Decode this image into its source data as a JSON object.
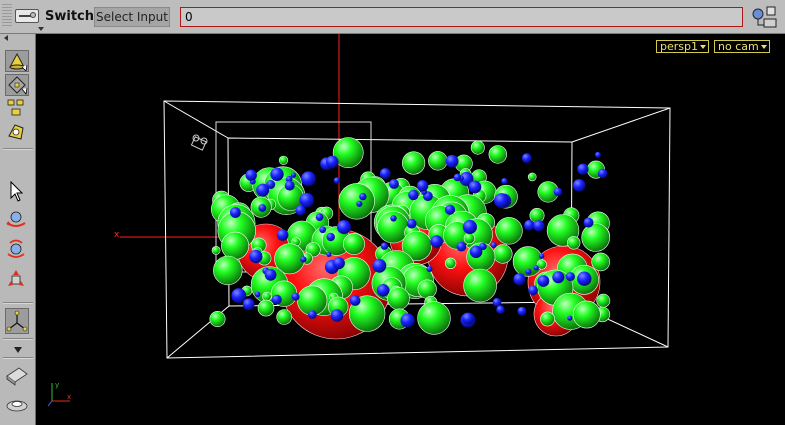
{
  "toolbar": {
    "node_type": "Switch",
    "select_input_label": "Select Input",
    "select_input_value": "0",
    "node_icon": "switch-node-icon",
    "right_icon": "network-display-icon"
  },
  "sidebar": {
    "tools": [
      {
        "name": "tool-select-shape",
        "icon": "cone-select-icon"
      },
      {
        "name": "tool-select-component",
        "icon": "cube-select-icon"
      },
      {
        "name": "tool-edit",
        "icon": "edit-points-icon"
      },
      {
        "name": "tool-handle",
        "icon": "handle-icon"
      },
      {
        "name": "tool-pointer",
        "icon": "pointer-arrow-icon"
      },
      {
        "name": "tool-rotate",
        "icon": "rotate-view-icon"
      },
      {
        "name": "tool-tumble",
        "icon": "tumble-view-icon"
      },
      {
        "name": "tool-scale",
        "icon": "scale-view-icon"
      },
      {
        "name": "tool-view",
        "icon": "view-tool-icon"
      },
      {
        "name": "tool-brush",
        "icon": "brush-icon"
      },
      {
        "name": "tool-display",
        "icon": "display-options-icon"
      }
    ]
  },
  "viewport": {
    "camera_menu": "persp1",
    "cam_menu": "no cam",
    "axis_label": "x",
    "colors": {
      "background": "#000000",
      "bounding_box": "#ffffff",
      "primary_spheres": "#ff2020",
      "secondary_spheres": "#22ff22",
      "tertiary_spheres": "#2030ff",
      "axis": "#ff2020"
    }
  }
}
